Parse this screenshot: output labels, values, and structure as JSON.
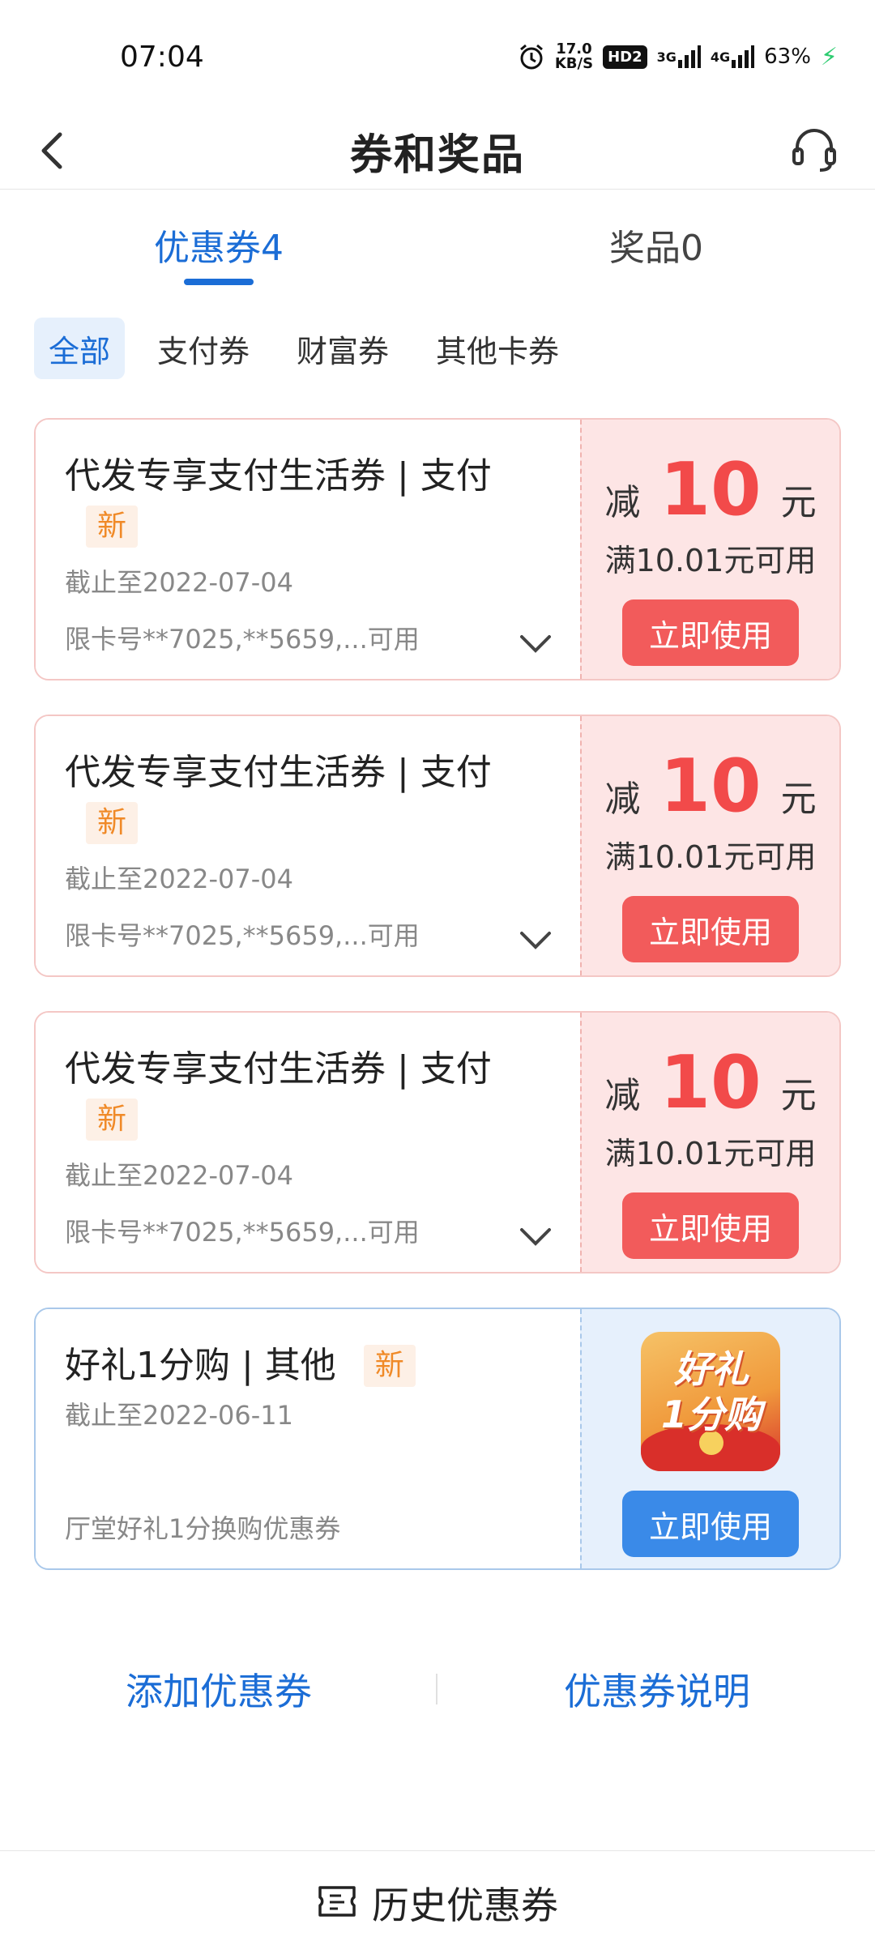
{
  "status_bar": {
    "time": "07:04",
    "speed_value": "17.0",
    "speed_unit": "KB/S",
    "hd": "HD2",
    "net1": "3G",
    "net2": "4G",
    "battery": "63%"
  },
  "nav": {
    "title": "券和奖品"
  },
  "tabs": [
    {
      "label": "优惠券4"
    },
    {
      "label": "奖品0"
    }
  ],
  "filters": [
    {
      "label": "全部"
    },
    {
      "label": "支付券"
    },
    {
      "label": "财富券"
    },
    {
      "label": "其他卡券"
    }
  ],
  "coupons": [
    {
      "title": "代发专享支付生活券 | 支付",
      "badge": "新",
      "expire": "截止至2022-07-04",
      "limit": "限卡号**7025,**5659,...可用",
      "prefix": "减",
      "amount": "10",
      "unit": "元",
      "condition": "满10.01元可用",
      "button": "立即使用"
    },
    {
      "title": "代发专享支付生活券 | 支付",
      "badge": "新",
      "expire": "截止至2022-07-04",
      "limit": "限卡号**7025,**5659,...可用",
      "prefix": "减",
      "amount": "10",
      "unit": "元",
      "condition": "满10.01元可用",
      "button": "立即使用"
    },
    {
      "title": "代发专享支付生活券 | 支付",
      "badge": "新",
      "expire": "截止至2022-07-04",
      "limit": "限卡号**7025,**5659,...可用",
      "prefix": "减",
      "amount": "10",
      "unit": "元",
      "condition": "满10.01元可用",
      "button": "立即使用"
    }
  ],
  "gift_coupon": {
    "title": "好礼1分购 | 其他",
    "badge": "新",
    "expire": "截止至2022-06-11",
    "desc": "厅堂好礼1分换购优惠券",
    "logo_line1": "好礼",
    "logo_line2": "1分购",
    "button": "立即使用"
  },
  "footer": {
    "add": "添加优惠券",
    "explain": "优惠券说明"
  },
  "bottom": {
    "history": "历史优惠券"
  },
  "colors": {
    "accent": "#1b6dd6",
    "coupon_red": "#f25b5b",
    "amount_red": "#f24a4a",
    "gift_blue": "#3a8ae8",
    "badge_orange": "#f08a28"
  }
}
